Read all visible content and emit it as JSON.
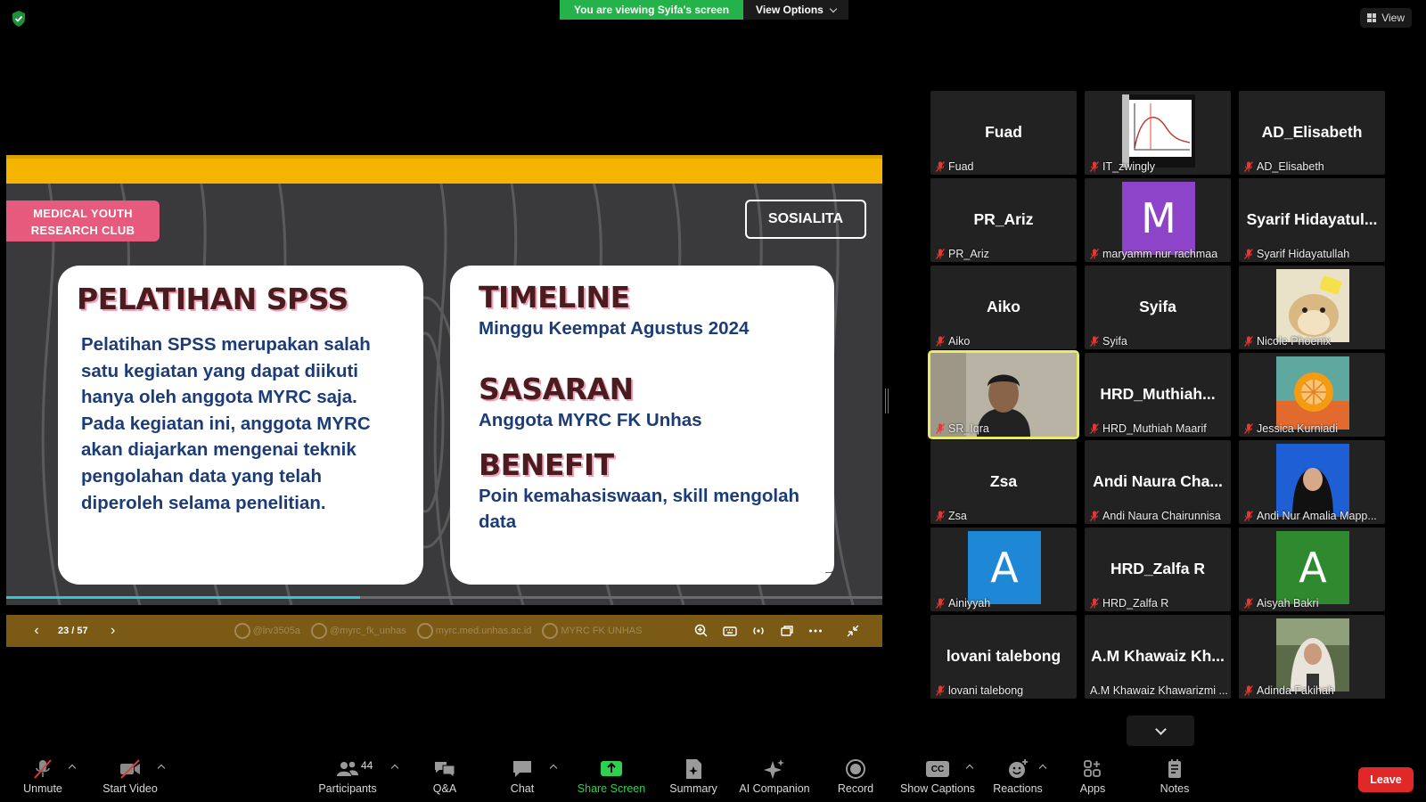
{
  "top_bar": {
    "viewing_banner": "You are viewing Syifa's screen",
    "view_options_label": "View Options",
    "view_label": "View"
  },
  "slide": {
    "club_badge_line1": "MEDICAL YOUTH",
    "club_badge_line2": "RESEARCH CLUB",
    "tag": "SOSIALITA",
    "left_card": {
      "heading": "PELATIHAN SPSS",
      "body": "Pelatihan SPSS merupakan salah satu kegiatan yang dapat diikuti hanya oleh anggota MYRC saja. Pada kegiatan ini, anggota MYRC akan diajarkan mengenai teknik pengolahan data yang telah diperoleh selama penelitian."
    },
    "right_card": {
      "heading1": "TIMELINE",
      "text1": "Minggu Keempat Agustus 2024",
      "heading2": "SASARAN",
      "text2": "Anggota MYRC FK Unhas",
      "heading3": "BENEFIT",
      "text3": "Poin kemahasiswaan, skill mengolah data"
    },
    "arrow_glyph": "→",
    "progress_fraction": 0.4035,
    "colors": {
      "accent_yellow": "#f5b400",
      "badge_pink": "#e55a7d",
      "heading_maroon": "#4a1c1f",
      "body_navy": "#1c3c78",
      "progress_cyan": "#2cc7d3"
    }
  },
  "slide_controls": {
    "page_indicator": "23 / 57",
    "socials": [
      "@lrv3505a",
      "@myrc_fk_unhas",
      "myrc.med.unhas.ac.id",
      "MYRC FK UNHAS"
    ]
  },
  "participants": [
    {
      "big_name": "Fuad",
      "label": "Fuad",
      "kind": "name"
    },
    {
      "big_name": "",
      "label": "IT_zwingly",
      "kind": "video-chart"
    },
    {
      "big_name": "AD_Elisabeth",
      "label": "AD_Elisabeth",
      "kind": "name"
    },
    {
      "big_name": "PR_Ariz",
      "label": "PR_Ariz",
      "kind": "name"
    },
    {
      "big_name": "M",
      "label": "maryamm nur rachmaa",
      "kind": "avatar",
      "color": "#8e44c9"
    },
    {
      "big_name": "Syarif  Hidayatul...",
      "label": "Syarif Hidayatullah",
      "kind": "name"
    },
    {
      "big_name": "Aiko",
      "label": "Aiko",
      "kind": "name"
    },
    {
      "big_name": "Syifa",
      "label": "Syifa",
      "kind": "name"
    },
    {
      "big_name": "",
      "label": "Nicole Phoenix",
      "kind": "photo-hamster"
    },
    {
      "big_name": "",
      "label": "SR_Iqra",
      "kind": "video-person",
      "active": true
    },
    {
      "big_name": "HRD_Muthiah...",
      "label": "HRD_Muthiah Maarif",
      "kind": "name"
    },
    {
      "big_name": "",
      "label": "Jessica Kurniadi",
      "kind": "photo-orange"
    },
    {
      "big_name": "Zsa",
      "label": "Zsa",
      "kind": "name"
    },
    {
      "big_name": "Andi  Naura  Cha...",
      "label": "Andi Naura Chairunnisa",
      "kind": "name"
    },
    {
      "big_name": "",
      "label": "Andi Nur Amalia Mapp...",
      "kind": "photo-hijab-blue"
    },
    {
      "big_name": "A",
      "label": "Ainiyyah",
      "kind": "avatar",
      "color": "#1e88d6"
    },
    {
      "big_name": "HRD_Zalfa R",
      "label": "HRD_Zalfa R",
      "kind": "name"
    },
    {
      "big_name": "A",
      "label": "Aisyah Bakri",
      "kind": "avatar",
      "color": "#2f8a2f"
    },
    {
      "big_name": "lovani talebong",
      "label": "lovani talebong",
      "kind": "name"
    },
    {
      "big_name": "A.M  Khawaiz  Kh...",
      "label": "A.M Khawaiz Khawarizmi ...",
      "kind": "name",
      "no_mic": true
    },
    {
      "big_name": "",
      "label": "Adinda Fakihah",
      "kind": "photo-hijab-white"
    }
  ],
  "toolbar": {
    "unmute": "Unmute",
    "start_video": "Start Video",
    "participants": "Participants",
    "participants_count": "44",
    "qa": "Q&A",
    "chat": "Chat",
    "share_screen": "Share Screen",
    "summary": "Summary",
    "ai_companion": "AI Companion",
    "record": "Record",
    "show_captions": "Show Captions",
    "cc_glyph": "CC",
    "reactions": "Reactions",
    "apps": "Apps",
    "notes": "Notes",
    "leave": "Leave",
    "colors": {
      "share_green": "#2ed14f",
      "leave_red": "#e02828"
    }
  }
}
